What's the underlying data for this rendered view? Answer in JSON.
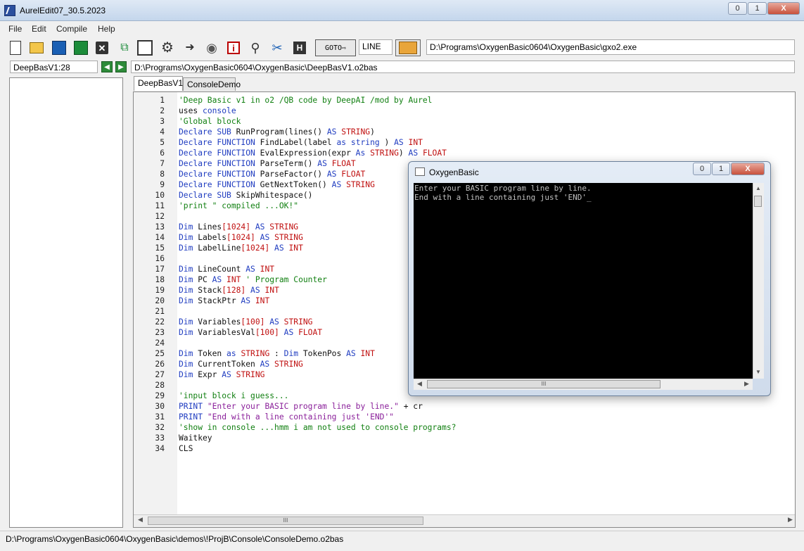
{
  "window": {
    "title": "AurelEdit07_30.5.2023",
    "minimize": "0",
    "maximize": "1",
    "close": "X"
  },
  "menu": [
    "File",
    "Edit",
    "Compile",
    "Help"
  ],
  "toolbar": {
    "goto_label": "GOTO⇨",
    "line_field": "LINE",
    "compiler_path": "D:\\Programs\\OxygenBasic0604\\OxygenBasic\\gxo2.exe",
    "icons": [
      "new-file-icon",
      "open-folder-icon",
      "save-icon",
      "save-as-icon",
      "close-icon",
      "run-icon",
      "console-icon",
      "settings-icon",
      "execute-icon",
      "globe-icon",
      "info-icon",
      "search-icon",
      "tools-icon",
      "help-icon"
    ]
  },
  "nav": {
    "position": "DeepBasV1:28",
    "prev": "◀",
    "next": "▶",
    "file_path": "D:\\Programs\\OxygenBasic0604\\OxygenBasic\\DeepBasV1.o2bas"
  },
  "tabs": [
    {
      "label": "DeepBasV1"
    },
    {
      "label": "ConsoleDemo"
    }
  ],
  "code_lines": [
    "'Deep Basic v1 in o2 /QB code by DeepAI /mod by Aurel",
    "uses console",
    "'Global block",
    "Declare SUB RunProgram(lines() AS STRING)",
    "Declare FUNCTION FindLabel(label as string ) AS INT",
    "Declare FUNCTION EvalExpression(expr As STRING) AS FLOAT",
    "Declare FUNCTION ParseTerm() AS FLOAT",
    "Declare FUNCTION ParseFactor() AS FLOAT",
    "Declare FUNCTION GetNextToken() AS STRING",
    "Declare SUB SkipWhitespace()",
    "'print \" compiled ...OK!\"",
    "",
    "Dim Lines[1024] AS STRING",
    "Dim Labels[1024] AS STRING",
    "Dim LabelLine[1024] AS INT",
    "",
    "Dim LineCount AS INT",
    "Dim PC AS INT ' Program Counter",
    "Dim Stack[128] AS INT",
    "Dim StackPtr AS INT",
    "",
    "Dim Variables[100] AS STRING",
    "Dim VariablesVal[100] AS FLOAT",
    "",
    "Dim Token as STRING : Dim TokenPos AS INT",
    "Dim CurrentToken AS STRING",
    "Dim Expr AS STRING",
    "",
    "'input block i guess...",
    "PRINT \"Enter your BASIC program line by line.\" + cr",
    "PRINT \"End with a line containing just 'END'\"",
    "'show in console ...hmm i am not used to console programs?",
    "Waitkey",
    "CLS"
  ],
  "editor": {
    "hscroll_thumb": "III"
  },
  "console": {
    "title": "OxygenBasic",
    "lines": [
      "Enter your BASIC program line by line.",
      "End with a line containing just 'END'"
    ],
    "cursor": "_",
    "hscroll_thumb": "III"
  },
  "status": {
    "text": "D:\\Programs\\OxygenBasic0604\\OxygenBasic\\demos\\!ProjB\\Console\\ConsoleDemo.o2bas"
  }
}
